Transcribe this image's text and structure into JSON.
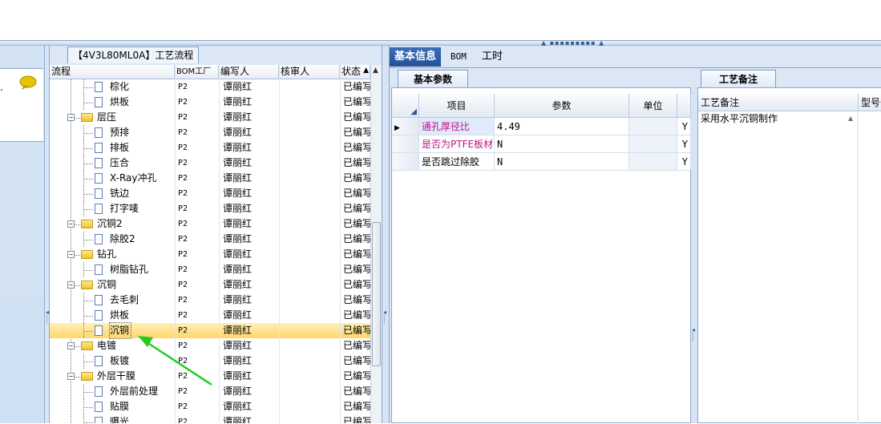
{
  "tree": {
    "title": "【4V3L80ML0A】工艺流程",
    "columns": [
      "流程",
      "BOM工厂",
      "编写人",
      "核审人",
      "状态"
    ],
    "rows": [
      {
        "name": "棕化",
        "type": "doc",
        "level": 2,
        "bom": "P2",
        "writer": "谭丽红",
        "reviewer": "",
        "status": "已编写"
      },
      {
        "name": "烘板",
        "type": "doc",
        "level": 2,
        "bom": "P2",
        "writer": "谭丽红",
        "reviewer": "",
        "status": "已编写"
      },
      {
        "name": "层压",
        "type": "folder",
        "level": 1,
        "bom": "P2",
        "writer": "谭丽红",
        "reviewer": "",
        "status": "已编写"
      },
      {
        "name": "预排",
        "type": "doc",
        "level": 2,
        "bom": "P2",
        "writer": "谭丽红",
        "reviewer": "",
        "status": "已编写"
      },
      {
        "name": "排板",
        "type": "doc",
        "level": 2,
        "bom": "P2",
        "writer": "谭丽红",
        "reviewer": "",
        "status": "已编写"
      },
      {
        "name": "压合",
        "type": "doc",
        "level": 2,
        "bom": "P2",
        "writer": "谭丽红",
        "reviewer": "",
        "status": "已编写"
      },
      {
        "name": "X-Ray冲孔",
        "type": "doc",
        "level": 2,
        "bom": "P2",
        "writer": "谭丽红",
        "reviewer": "",
        "status": "已编写"
      },
      {
        "name": "铣边",
        "type": "doc",
        "level": 2,
        "bom": "P2",
        "writer": "谭丽红",
        "reviewer": "",
        "status": "已编写"
      },
      {
        "name": "打字唛",
        "type": "doc",
        "level": 2,
        "bom": "P2",
        "writer": "谭丽红",
        "reviewer": "",
        "status": "已编写"
      },
      {
        "name": "沉铜2",
        "type": "folder",
        "level": 1,
        "bom": "P2",
        "writer": "谭丽红",
        "reviewer": "",
        "status": "已编写"
      },
      {
        "name": "除胶2",
        "type": "doc",
        "level": 2,
        "bom": "P2",
        "writer": "谭丽红",
        "reviewer": "",
        "status": "已编写"
      },
      {
        "name": "钻孔",
        "type": "folder",
        "level": 1,
        "bom": "P2",
        "writer": "谭丽红",
        "reviewer": "",
        "status": "已编写"
      },
      {
        "name": "树脂钻孔",
        "type": "doc",
        "level": 2,
        "bom": "P2",
        "writer": "谭丽红",
        "reviewer": "",
        "status": "已编写"
      },
      {
        "name": "沉铜",
        "type": "folder",
        "level": 1,
        "bom": "P2",
        "writer": "谭丽红",
        "reviewer": "",
        "status": "已编写"
      },
      {
        "name": "去毛刺",
        "type": "doc",
        "level": 2,
        "bom": "P2",
        "writer": "谭丽红",
        "reviewer": "",
        "status": "已编写"
      },
      {
        "name": "烘板",
        "type": "doc",
        "level": 2,
        "bom": "P2",
        "writer": "谭丽红",
        "reviewer": "",
        "status": "已编写"
      },
      {
        "name": "沉铜",
        "type": "doc",
        "level": 2,
        "bom": "P2",
        "writer": "谭丽红",
        "reviewer": "",
        "status": "已编写",
        "selected": true
      },
      {
        "name": "电镀",
        "type": "folder",
        "level": 1,
        "bom": "P2",
        "writer": "谭丽红",
        "reviewer": "",
        "status": "已编写"
      },
      {
        "name": "板镀",
        "type": "doc",
        "level": 2,
        "bom": "P2",
        "writer": "谭丽红",
        "reviewer": "",
        "status": "已编写"
      },
      {
        "name": "外层干膜",
        "type": "folder",
        "level": 1,
        "bom": "P2",
        "writer": "谭丽红",
        "reviewer": "",
        "status": "已编写"
      },
      {
        "name": "外层前处理",
        "type": "doc",
        "level": 2,
        "bom": "P2",
        "writer": "谭丽红",
        "reviewer": "",
        "status": "已编写"
      },
      {
        "name": "贴膜",
        "type": "doc",
        "level": 2,
        "bom": "P2",
        "writer": "谭丽红",
        "reviewer": "",
        "status": "已编写"
      },
      {
        "name": "曝光",
        "type": "doc",
        "level": 2,
        "bom": "P2",
        "writer": "谭丽红",
        "reviewer": "",
        "status": "已编写"
      }
    ]
  },
  "right_tabs": [
    "基本信息",
    "BOM",
    "工时"
  ],
  "params": {
    "tab_label": "基本参数",
    "headers": [
      "项目",
      "参数",
      "单位"
    ],
    "rows": [
      {
        "item": "通孔厚径比",
        "value": "4.49",
        "unit": "",
        "flag": "Y",
        "highlight": true
      },
      {
        "item": "是否为PTFE板材",
        "value": "N",
        "unit": "",
        "flag": "Y",
        "highlight": true
      },
      {
        "item": "是否跳过除胶",
        "value": "N",
        "unit": "",
        "flag": "Y",
        "highlight": false
      }
    ]
  },
  "remarks": {
    "tab_label": "工艺备注",
    "headers": [
      "工艺备注",
      "型号备"
    ],
    "text": "采用水平沉铜制作"
  },
  "colors": {
    "accent": "#234f94",
    "highlight_text": "#c0128c",
    "selected_row": "#ffd66a",
    "arrow": "#22cc22"
  },
  "icons": [
    "chat-bubble-icon",
    "folder-icon",
    "document-icon",
    "expand-icon",
    "scroll-up-icon"
  ]
}
